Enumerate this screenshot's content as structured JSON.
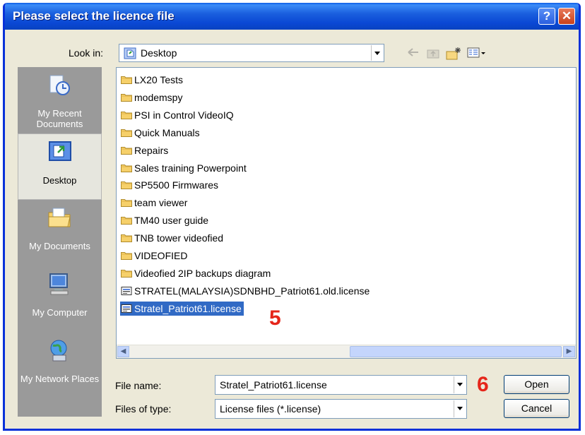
{
  "dialog": {
    "title": "Please select the licence file"
  },
  "toolbar": {
    "look_in_label": "Look in:",
    "look_in_value": "Desktop"
  },
  "places": [
    {
      "label": "My Recent Documents",
      "icon": "recent-documents-icon"
    },
    {
      "label": "Desktop",
      "icon": "desktop-icon"
    },
    {
      "label": "My Documents",
      "icon": "my-documents-icon"
    },
    {
      "label": "My Computer",
      "icon": "my-computer-icon"
    },
    {
      "label": "My Network Places",
      "icon": "network-places-icon"
    }
  ],
  "files": [
    {
      "name": "LX20 Tests",
      "type": "folder"
    },
    {
      "name": "modemspy",
      "type": "folder"
    },
    {
      "name": "PSI in Control VideoIQ",
      "type": "folder"
    },
    {
      "name": "Quick Manuals",
      "type": "folder"
    },
    {
      "name": "Repairs",
      "type": "folder"
    },
    {
      "name": "Sales training Powerpoint",
      "type": "folder"
    },
    {
      "name": "SP5500 Firmwares",
      "type": "folder"
    },
    {
      "name": "team viewer",
      "type": "folder"
    },
    {
      "name": "TM40 user guide",
      "type": "folder"
    },
    {
      "name": "TNB tower videofied",
      "type": "folder"
    },
    {
      "name": "VIDEOFIED",
      "type": "folder"
    },
    {
      "name": "Videofied 2IP backups diagram",
      "type": "folder"
    },
    {
      "name": "STRATEL(MALAYSIA)SDNBHD_Patriot61.old.license",
      "type": "file"
    },
    {
      "name": "Stratel_Patriot61.license",
      "type": "file",
      "selected": true
    }
  ],
  "form": {
    "file_name_label": "File name:",
    "file_name_value": "Stratel_Patriot61.license",
    "file_type_label": "Files of type:",
    "file_type_value": "License files (*.license)",
    "open_label": "Open",
    "cancel_label": "Cancel"
  },
  "annotations": {
    "step5": "5",
    "step6": "6"
  }
}
